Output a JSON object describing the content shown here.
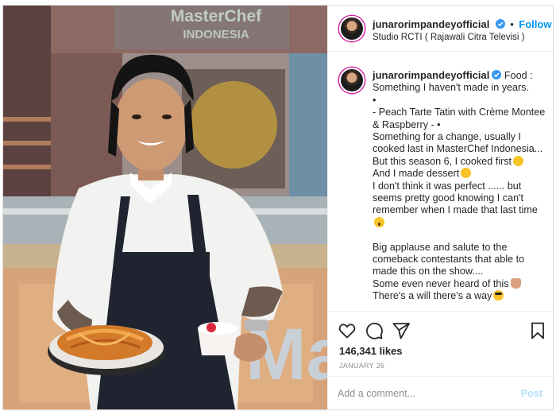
{
  "post": {
    "photo_sign_line1": "MasterChef",
    "photo_sign_line2": "INDONESIA",
    "photo_watermark": "Ma"
  },
  "header": {
    "username": "junarorimpandeyofficial",
    "separator": "•",
    "follow_label": "Follow",
    "location": "Studio RCTI ( Rajawali Citra Televisi )"
  },
  "caption": {
    "username": "junarorimpandeyofficial",
    "lines": [
      "Food :",
      "Something I haven't made in years.",
      "•",
      "- Peach Tarte Tatin with Crème Montee",
      "& Raspberry - •",
      "Something for a change, usually I",
      "cooked last in MasterChef Indonesia...",
      "But this season 6, I cooked first",
      "And I made dessert",
      "I don't think it was perfect ...... but",
      "seems pretty good knowing I can't",
      "remember when I made that last time",
      "",
      "",
      "Big applause and salute to the",
      "comeback contestants that able to",
      "made this on the show....",
      "Some even never heard of this",
      "There's a will there's a way"
    ]
  },
  "actions": {
    "like_icon": "heart-icon",
    "comment_icon": "comment-icon",
    "share_icon": "paper-plane-icon",
    "save_icon": "bookmark-icon",
    "likes": "146,341 likes",
    "date": "JANUARY 26"
  },
  "comment": {
    "placeholder": "Add a comment...",
    "post_label": "Post"
  },
  "colors": {
    "accent": "#0095f6",
    "post_disabled": "#b2dffc",
    "text": "#262626",
    "muted": "#8e8e8e"
  }
}
